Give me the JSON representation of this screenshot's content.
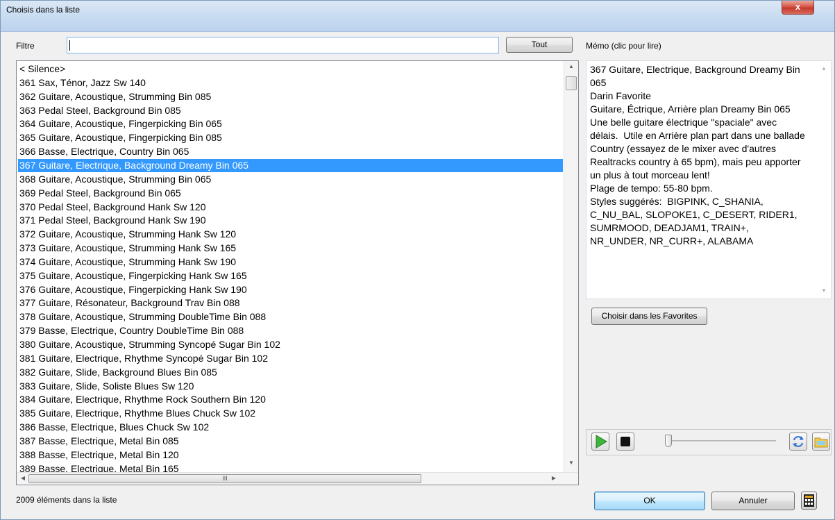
{
  "window": {
    "title": "Choisis dans la liste",
    "close_label": "x"
  },
  "filter": {
    "label": "Filtre",
    "value": "",
    "all_button": "Tout"
  },
  "list": {
    "items": [
      "< Silence>",
      "361 Sax, Ténor, Jazz Sw 140",
      "362 Guitare, Acoustique, Strumming Bin 085",
      "363 Pedal Steel, Background Bin 085",
      "364 Guitare, Acoustique, Fingerpicking Bin 065",
      "365 Guitare, Acoustique, Fingerpicking Bin 085",
      "366 Basse, Electrique, Country Bin 065",
      "367 Guitare, Electrique, Background Dreamy Bin 065",
      "368 Guitare, Acoustique, Strumming Bin 065",
      "369 Pedal Steel, Background Bin 065",
      "370 Pedal Steel, Background Hank Sw 120",
      "371 Pedal Steel, Background Hank Sw 190",
      "372 Guitare, Acoustique, Strumming Hank Sw 120",
      "373 Guitare, Acoustique, Strumming Hank Sw 165",
      "374 Guitare, Acoustique, Strumming Hank Sw 190",
      "375 Guitare, Acoustique, Fingerpicking Hank Sw 165",
      "376 Guitare, Acoustique, Fingerpicking Hank Sw 190",
      "377 Guitare, Résonateur, Background Trav Bin 088",
      "378 Guitare, Acoustique, Strumming DoubleTime Bin 088",
      "379 Basse, Electrique, Country DoubleTime Bin 088",
      "380 Guitare, Acoustique, Strumming Syncopé Sugar Bin 102",
      "381 Guitare, Electrique, Rhythme Syncopé Sugar Bin 102",
      "382 Guitare, Slide, Background Blues Bin 085",
      "383 Guitare, Slide, Soliste Blues Sw 120",
      "384 Guitare, Electrique, Rhythme Rock Southern Bin 120",
      "385 Guitare, Electrique, Rhythme Blues Chuck Sw 102",
      "386 Basse, Electrique, Blues Chuck Sw 102",
      "387 Basse, Electrique, Metal Bin 085",
      "388 Basse, Electrique, Metal Bin 120",
      "389 Basse, Electrique, Metal Bin 165"
    ],
    "selected_index": 7,
    "status": "2009 éléments dans la liste",
    "hscroll_grip": "III"
  },
  "memo": {
    "label": "Mémo (clic pour lire)",
    "text": "367 Guitare, Electrique, Background Dreamy Bin 065\nDarin Favorite\nGuitare, Éctrique, Arrière plan Dreamy Bin 065\nUne belle guitare électrique \"spaciale\" avec délais.  Utile en Arrière plan part dans une ballade Country (essayez de le mixer avec d'autres Realtracks country à 65 bpm), mais peu apporter un plus à tout morceau lent!\nPlage de tempo: 55-80 bpm.\nStyles suggérés:  BIGPINK, C_SHANIA, C_NU_BAL, SLOPOKE1, C_DESERT, RIDER1, SUMRMOOD, DEADJAM1, TRAIN+, NR_UNDER, NR_CURR+, ALABAMA",
    "favorites_button": "Choisir dans les Favorites"
  },
  "player": {
    "position": 0.0
  },
  "buttons": {
    "ok": "OK",
    "cancel": "Annuler"
  },
  "colors": {
    "selection": "#3399ff",
    "play_green": "#3fb53f",
    "close_red": "#c8453a"
  }
}
